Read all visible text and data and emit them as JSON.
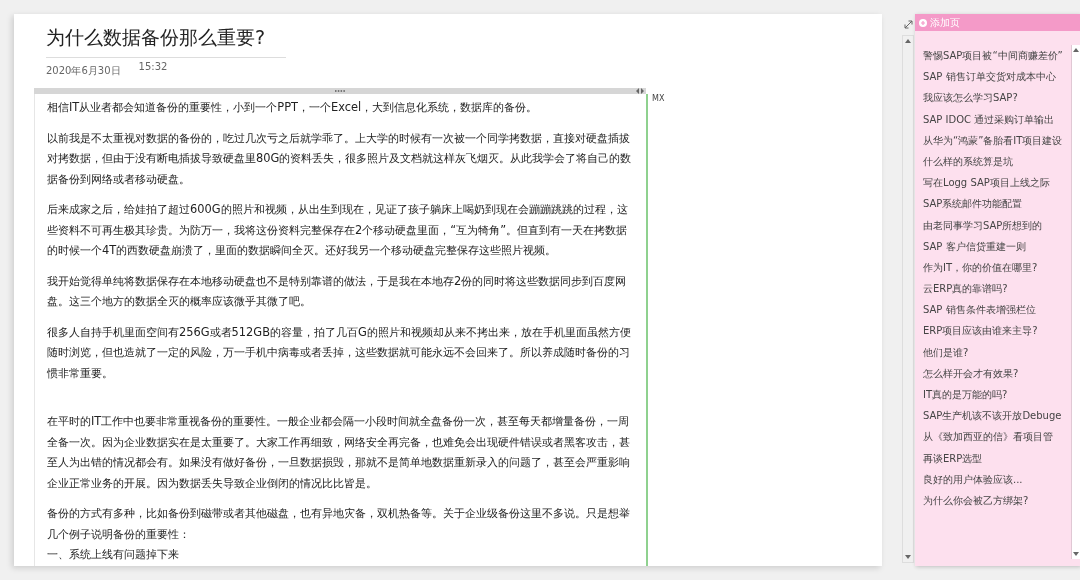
{
  "page": {
    "title": "为什么数据备份那么重要?",
    "date": "2020年6月30日",
    "time": "15:32"
  },
  "note": {
    "author": "MX",
    "paragraphs": [
      {
        "kind": "paragraph",
        "text": "相信IT从业者都会知道备份的重要性，小到一个PPT，一个Excel，大到信息化系统，数据库的备份。"
      },
      {
        "kind": "paragraph",
        "text": "以前我是不太重视对数据的备份的，吃过几次亏之后就学乖了。上大学的时候有一次被一个同学拷数据，直接对硬盘插拔对拷数据，但由于没有断电插拔导致硬盘里80G的资料丢失，很多照片及文档就这样灰飞烟灭。从此我学会了将自己的数据备份到网络或者移动硬盘。"
      },
      {
        "kind": "paragraph",
        "text": "后来成家之后，给娃拍了超过600G的照片和视频，从出生到现在，见证了孩子躺床上喝奶到现在会蹦蹦跳跳的过程，这些资料不可再生极其珍贵。为防万一，我将这份资料完整保存在2个移动硬盘里面，“互为犄角”。但直到有一天在拷数据的时候一个4T的西数硬盘崩溃了，里面的数据瞬间全灭。还好我另一个移动硬盘完整保存这些照片视频。"
      },
      {
        "kind": "paragraph",
        "text": "我开始觉得单纯将数据保存在本地移动硬盘也不是特别靠谱的做法，于是我在本地存2份的同时将这些数据同步到百度网盘。这三个地方的数据全灭的概率应该微乎其微了吧。"
      },
      {
        "kind": "paragraph",
        "text": "很多人自持手机里面空间有256G或者512GB的容量，拍了几百G的照片和视频却从来不拷出来，放在手机里面虽然方便随时浏览，但也造就了一定的风险，万一手机中病毒或者丢掉，这些数据就可能永远不会回来了。所以养成随时备份的习惯非常重要。"
      },
      {
        "kind": "after_blank",
        "text": "在平时的IT工作中也要非常重视备份的重要性。一般企业都会隔一小段时间就全盘备份一次，甚至每天都增量备份，一周全备一次。因为企业数据实在是太重要了。大家工作再细致，网络安全再完备，也难免会出现硬件错误或者黑客攻击，甚至人为出错的情况都会有。如果没有做好备份，一旦数据损毁，那就不是简单地数据重新录入的问题了，甚至会严重影响企业正常业务的开展。因为数据丢失导致企业倒闭的情况比比皆是。"
      },
      {
        "kind": "paragraph",
        "text": "备份的方式有多种，比如备份到磁带或者其他磁盘，也有异地灾备，双机热备等。关于企业级备份这里不多说。只是想举几个例子说明备份的重要性："
      },
      {
        "kind": "line",
        "text": "一、系统上线有问题掉下来"
      }
    ]
  },
  "sidebar": {
    "add_page": "添加页",
    "pages": [
      {
        "title": "警惕SAP项目被“中间商赚差价”",
        "selected": false
      },
      {
        "title": "SAP 销售订单交货对成本中心",
        "selected": false
      },
      {
        "title": "我应该怎么学习SAP?",
        "selected": false
      },
      {
        "title": "SAP IDOC 通过采购订单输出",
        "selected": false
      },
      {
        "title": "从华为“鸿蒙”备胎看IT项目建设",
        "selected": false
      },
      {
        "title": "什么样的系统算是坑",
        "selected": false
      },
      {
        "title": "写在Logg SAP项目上线之际",
        "selected": false
      },
      {
        "title": "SAP系统邮件功能配置",
        "selected": false
      },
      {
        "title": "由老同事学习SAP所想到的",
        "selected": false
      },
      {
        "title": "SAP 客户信贷重建一则",
        "selected": false
      },
      {
        "title": "作为IT，你的价值在哪里?",
        "selected": false
      },
      {
        "title": "云ERP真的靠谱吗?",
        "selected": false
      },
      {
        "title": "SAP 销售条件表增强栏位",
        "selected": false
      },
      {
        "title": "ERP项目应该由谁来主导?",
        "selected": false
      },
      {
        "title": "他们是谁?",
        "selected": false
      },
      {
        "title": "怎么样开会才有效果?",
        "selected": false
      },
      {
        "title": "IT真的是万能的吗?",
        "selected": false
      },
      {
        "title": "SAP生产机该不该开放Debuge",
        "selected": false
      },
      {
        "title": "从《致加西亚的信》看项目管",
        "selected": false
      },
      {
        "title": "再谈ERP选型",
        "selected": false
      },
      {
        "title": "良好的用户体验应该...",
        "selected": false
      },
      {
        "title": "为什么你会被乙方绑架?",
        "selected": false
      }
    ]
  }
}
